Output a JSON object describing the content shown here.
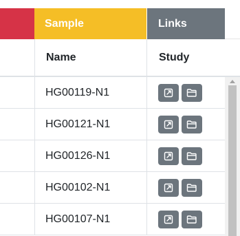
{
  "header_groups": {
    "sample": "Sample",
    "links": "Links"
  },
  "columns": {
    "name": "Name",
    "study": "Study"
  },
  "colors": {
    "left_group": "#d63347",
    "sample_group": "#f5be26",
    "links_group": "#6c757d",
    "button": "#6c757d"
  },
  "icons": {
    "open": "external-link-icon",
    "folder": "folder-icon"
  },
  "rows": [
    {
      "name": "HG00119-N1"
    },
    {
      "name": "HG00121-N1"
    },
    {
      "name": "HG00126-N1"
    },
    {
      "name": "HG00102-N1"
    },
    {
      "name": "HG00107-N1"
    }
  ]
}
